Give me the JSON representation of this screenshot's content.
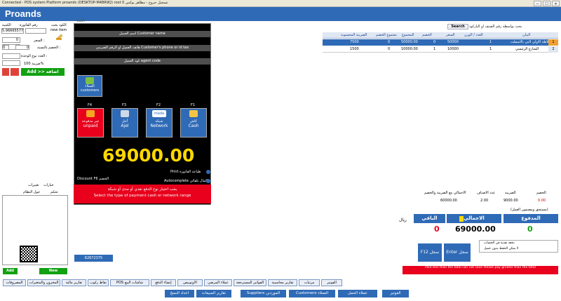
{
  "window": {
    "title": "Connected - POS system Platform proands (DESKTOP-M4BR9Q) root 0 تسجيل خروج - مظاهر بوكس",
    "min": "—",
    "max": "☐",
    "close": "✕"
  },
  "app": {
    "brand": "Proands"
  },
  "left_panel": {
    "qty_label": "الكمية",
    "code_label": "رقم الفاتورة",
    "item_label": "الكود بحث",
    "code_value": "5.96665577",
    "new_item": "new item",
    "qty_value": "0",
    "price_label": "السعر :",
    "price_value": "",
    "discount_label": "الخصم بالنسبة :",
    "disc_a": "0",
    "disc_b": "0",
    "tax_count_label": "العدد نوع الوحدة :",
    "tax_label": "ضريبة 100%",
    "add_label": "Add >> اضافه",
    "tabs": [
      "تحكم",
      "خيارات",
      "تغييرات"
    ],
    "show_label": "حول النظام",
    "add_new": "Add",
    "new_label": "New"
  },
  "search": {
    "placeholder": "بحث بواسطة رقم الصنف او الباركود",
    "button": "Search"
  },
  "grid": {
    "headers": [
      "البيان",
      "العدد / الوزن",
      "السعر",
      "الخصم",
      "المجموع",
      "مجموع الخصم",
      "الضريبة المحسوبة"
    ],
    "rows": [
      {
        "num": "1",
        "name": "البلاطة الاولي التي بالاسفلت",
        "count": "1",
        "price": "50000",
        "discount": "0",
        "total": "50000.00",
        "disc_total": "0",
        "tax": "7500"
      },
      {
        "num": "2",
        "name": "الشارع الرئيسي",
        "count": "1",
        "price": "10000",
        "discount": "1",
        "total": "10000.00",
        "disc_total": "0",
        "tax": "1500"
      }
    ]
  },
  "pay": {
    "cust_name": "اسم العميل Customer name",
    "cust_phone": "هاتف العميل او الرقم الضريبي Customer's phone or id tax",
    "agent_code": "كود العميل agent code",
    "customers": "customers",
    "customers_ar": "العملاء",
    "f_keys": [
      "F4",
      "F3",
      "F2",
      "F1"
    ],
    "tiles": [
      {
        "ar": "غير مدفوعة",
        "en": "unpaid"
      },
      {
        "ar": "آجل",
        "en": "Ajel"
      },
      {
        "ar": "شبكة",
        "en": "Network"
      },
      {
        "ar": "كاش",
        "en": "Cash"
      }
    ],
    "mada": "mada",
    "total": "69000.00",
    "print_label": "Print طباعة الفاتورة",
    "discount_label": "Discount F6 الخصم",
    "autocomplete": "Autocomplete اكمال تلقائي",
    "note_ar": "يجب اختيار نوع الدفع نقدي أو مدى أو شبكة",
    "note_en": "Select the type of payment cash or network range",
    "cash_label": "Cash"
  },
  "summary": {
    "headers": [
      "الخصم",
      "الضريبة",
      "عدد الاصناف",
      "الاجمالي مع الضريبة والخصم"
    ],
    "values": [
      "0.00",
      "9000.00",
      "2.00",
      "60000.00"
    ],
    "reverse": "(مستحق ومضمون العمل)",
    "paid_label": "المدفوع",
    "total_label": "الاجمالي",
    "remain_label": "الباقي",
    "paid": "0",
    "total": "69000.00",
    "remain": "0",
    "currency": "ريال"
  },
  "lower_right": {
    "enter": "Enter سجل",
    "f12": "F12 سجل",
    "check1": "دفعة نقدية في الحساب",
    "check2": "لا يمكن الحفظ بدون عميل",
    "error": "Paid less than the total can not save Please pay greater than the total",
    "phone": "62672375"
  },
  "taskbar": {
    "row1": [
      "المصروفات",
      "المخزون والمتغيرات",
      "تقارير مالية",
      "نقاط ركوب",
      "POS شاشات البيع",
      "إنشاء الدفع",
      "الاوتوبيص",
      "عملاء المرضي",
      "الفواتير المسترجعة",
      "تقارير محاسبية",
      "مرتبات",
      "الفوتير"
    ],
    "row2": [
      "اعداد النسخ",
      "تقارير المبيعات",
      "Suppliers الموردين",
      "Customers العملاء",
      "عملاء الحمل",
      "الفوتير"
    ]
  }
}
